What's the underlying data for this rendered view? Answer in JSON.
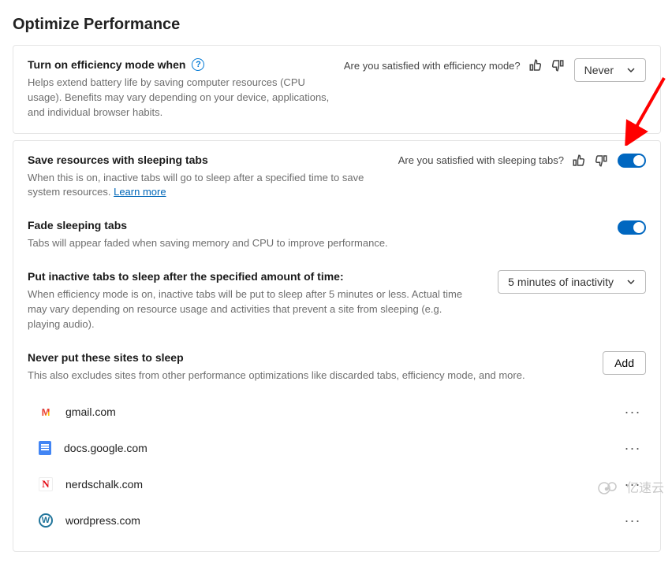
{
  "page": {
    "title": "Optimize Performance"
  },
  "efficiency": {
    "title": "Turn on efficiency mode when",
    "desc": "Helps extend battery life by saving computer resources (CPU usage). Benefits may vary depending on your device, applications, and individual browser habits.",
    "feedback_q": "Are you satisfied with efficiency mode?",
    "select_value": "Never"
  },
  "sleeping": {
    "title": "Save resources with sleeping tabs",
    "desc": "When this is on, inactive tabs will go to sleep after a specified time to save system resources. ",
    "learn_more": "Learn more",
    "feedback_q": "Are you satisfied with sleeping tabs?",
    "toggle_on": true
  },
  "fade": {
    "title": "Fade sleeping tabs",
    "desc": "Tabs will appear faded when saving memory and CPU to improve performance.",
    "toggle_on": true
  },
  "timeout": {
    "title": "Put inactive tabs to sleep after the specified amount of time:",
    "desc": "When efficiency mode is on, inactive tabs will be put to sleep after 5 minutes or less. Actual time may vary depending on resource usage and activities that prevent a site from sleeping (e.g. playing audio).",
    "select_value": "5 minutes of inactivity"
  },
  "never": {
    "title": "Never put these sites to sleep",
    "desc": "This also excludes sites from other performance optimizations like discarded tabs, efficiency mode, and more.",
    "add_label": "Add",
    "sites": [
      {
        "domain": "gmail.com",
        "icon": "gmail"
      },
      {
        "domain": "docs.google.com",
        "icon": "docs"
      },
      {
        "domain": "nerdschalk.com",
        "icon": "n"
      },
      {
        "domain": "wordpress.com",
        "icon": "wp"
      }
    ]
  },
  "watermark": "亿速云"
}
